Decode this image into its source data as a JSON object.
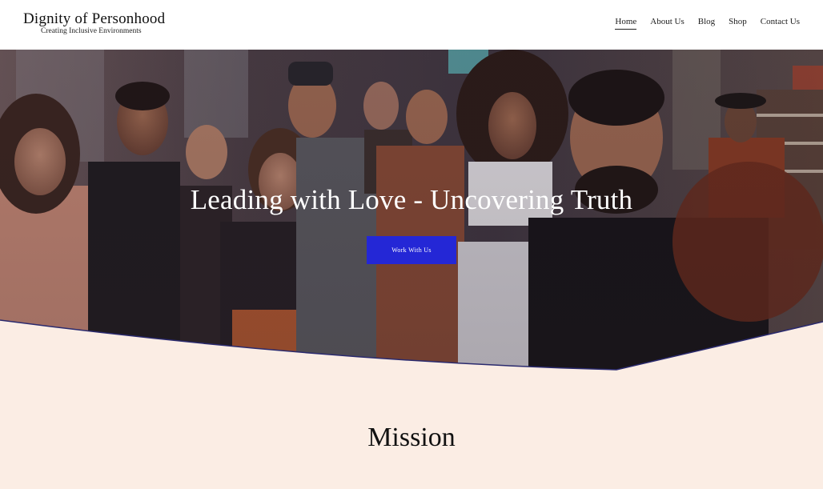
{
  "brand": {
    "title": "Dignity of Personhood",
    "tagline": "Creating Inclusive Environments"
  },
  "nav": {
    "items": [
      {
        "label": "Home",
        "active": true
      },
      {
        "label": "About Us",
        "active": false
      },
      {
        "label": "Blog",
        "active": false
      },
      {
        "label": "Shop",
        "active": false
      },
      {
        "label": "Contact Us",
        "active": false
      }
    ]
  },
  "hero": {
    "headline": "Leading with Love - Uncovering Truth",
    "cta_label": "Work With Us",
    "image_subject": "group-of-people-photo"
  },
  "mission": {
    "title": "Mission"
  },
  "colors": {
    "accent": "#2427d6",
    "section_bg": "#fbede4",
    "header_bg": "#ffffff",
    "wave_line": "#2a2a6e"
  }
}
